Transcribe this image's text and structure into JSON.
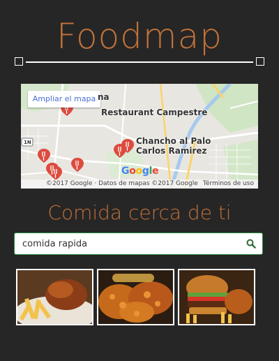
{
  "header": {
    "title": "Foodmap"
  },
  "map": {
    "expand_label": "Ampliar el mapa",
    "places": [
      "na",
      "Restaurant Campestre",
      "Chancho al Palo",
      "Carlos Ramirez"
    ],
    "logo": "Google",
    "copyright": "©2017 Google · Datos de mapas ©2017 Google",
    "terms": "Términos de uso",
    "road_marker": "1N",
    "marker_icon": "restaurant-marker-icon"
  },
  "section": {
    "title": "Comida cerca de ti"
  },
  "search": {
    "value": "comida rapida",
    "icon": "search-icon",
    "accent": "#2d8a3e"
  },
  "thumbnails": [
    {
      "name": "roast-chicken-fries"
    },
    {
      "name": "fried-chicken"
    },
    {
      "name": "burger-fries"
    }
  ],
  "colors": {
    "background": "#262626",
    "accent": "#c0713a"
  }
}
